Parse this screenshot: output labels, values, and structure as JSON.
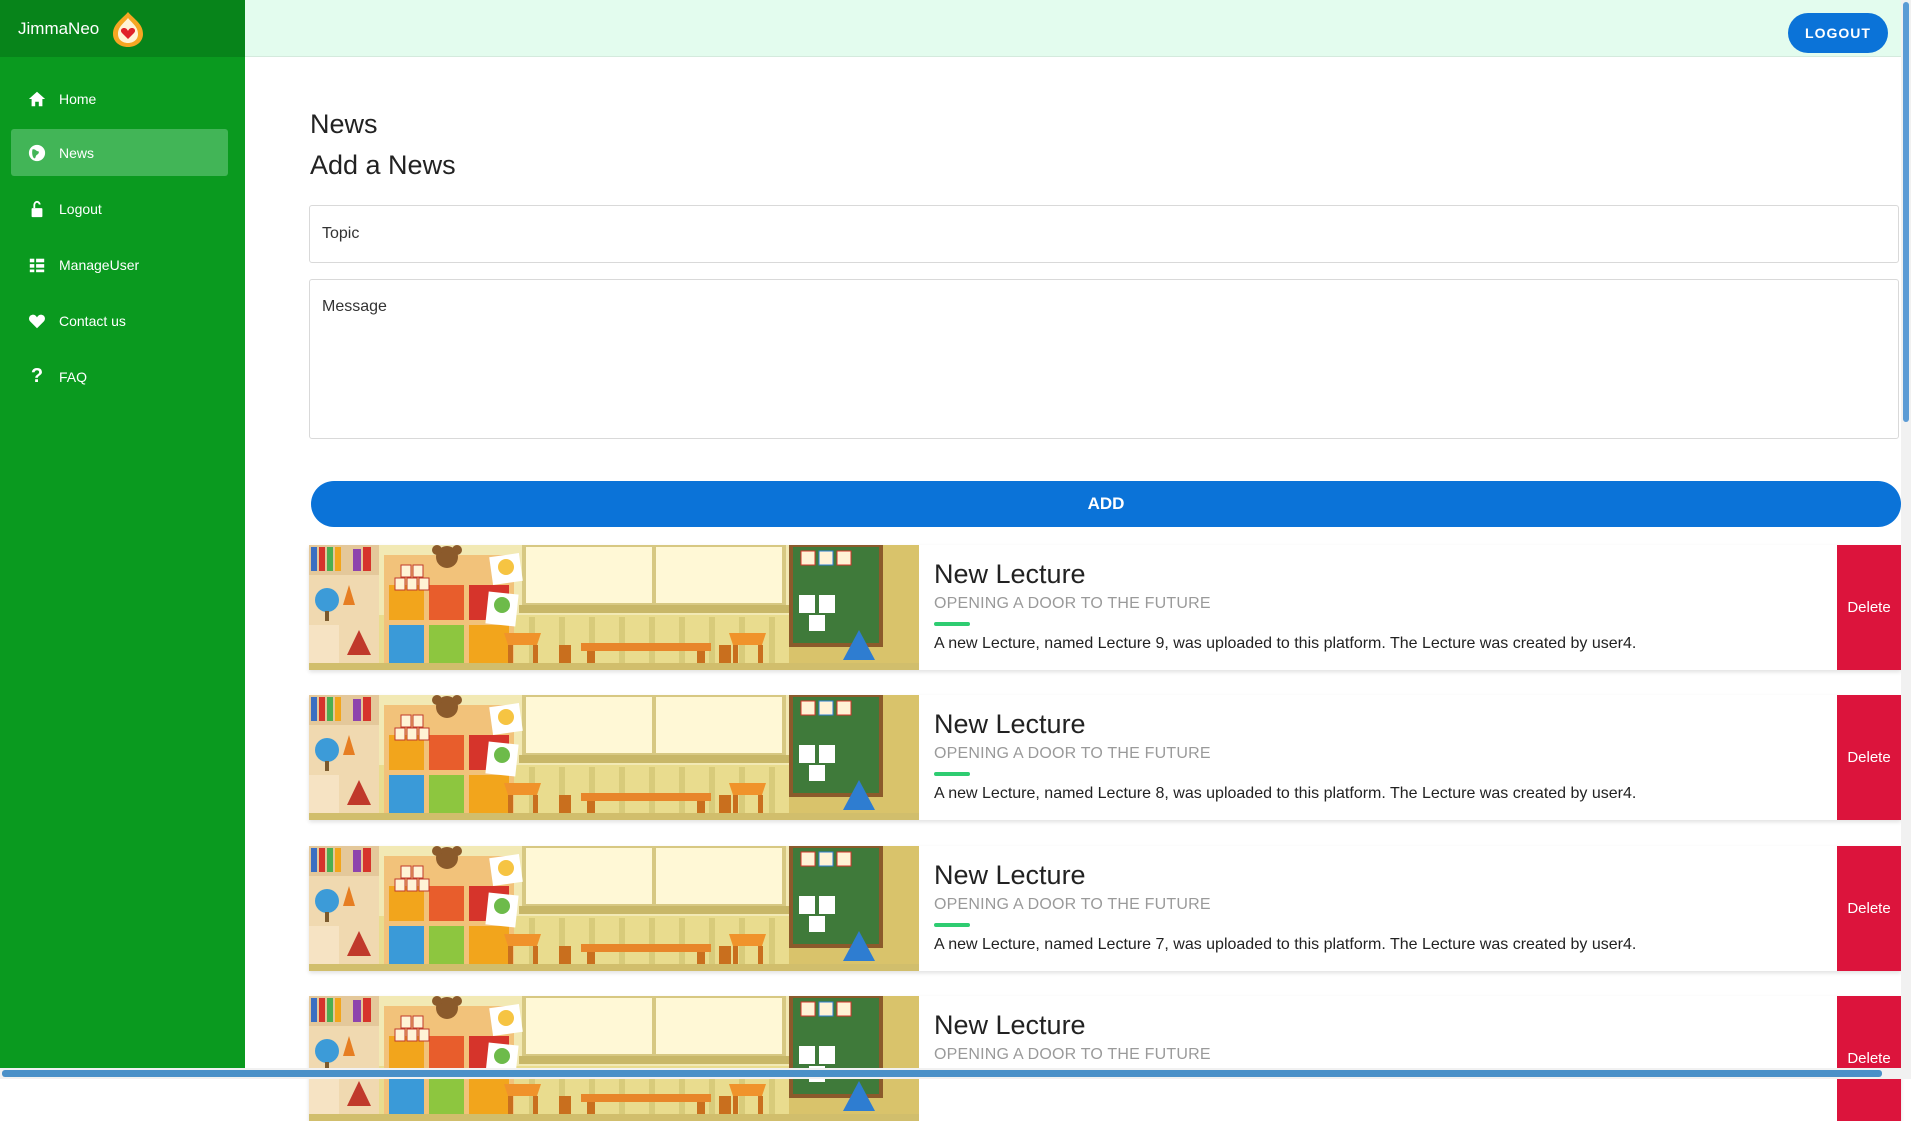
{
  "app": {
    "brand": "JimmaNeo"
  },
  "sidebar": {
    "items": [
      {
        "label": "Home",
        "icon": "home-icon"
      },
      {
        "label": "News",
        "icon": "globe-icon",
        "active": true
      },
      {
        "label": "Logout",
        "icon": "lock-icon"
      },
      {
        "label": "ManageUser",
        "icon": "list-icon"
      },
      {
        "label": "Contact us",
        "icon": "heart-icon"
      },
      {
        "label": "FAQ",
        "icon": "question-icon"
      }
    ]
  },
  "header": {
    "logout_label": "LOGOUT"
  },
  "main": {
    "heading": "News",
    "subheading": "Add a News",
    "topic_placeholder": "Topic",
    "message_placeholder": "Message",
    "add_label": "ADD"
  },
  "news": [
    {
      "title": "New Lecture",
      "subtitle": "OPENING A DOOR TO THE FUTURE",
      "body": "A new Lecture, named Lecture 9, was uploaded to this platform. The Lecture was created by user4.",
      "delete_label": "Delete"
    },
    {
      "title": "New Lecture",
      "subtitle": "OPENING A DOOR TO THE FUTURE",
      "body": "A new Lecture, named Lecture 8, was uploaded to this platform. The Lecture was created by user4.",
      "delete_label": "Delete"
    },
    {
      "title": "New Lecture",
      "subtitle": "OPENING A DOOR TO THE FUTURE",
      "body": "A new Lecture, named Lecture 7, was uploaded to this platform. The Lecture was created by user4.",
      "delete_label": "Delete"
    },
    {
      "title": "New Lecture",
      "subtitle": "OPENING A DOOR TO THE FUTURE",
      "body": "",
      "delete_label": "Delete"
    }
  ],
  "colors": {
    "sidebar": "#0a9a1f",
    "brand_bar": "#07841a",
    "active_item": "#42b557",
    "topbar": "#e3fcee",
    "primary": "#0b73d8",
    "delete": "#dc143c",
    "accent": "#2ecc71"
  }
}
